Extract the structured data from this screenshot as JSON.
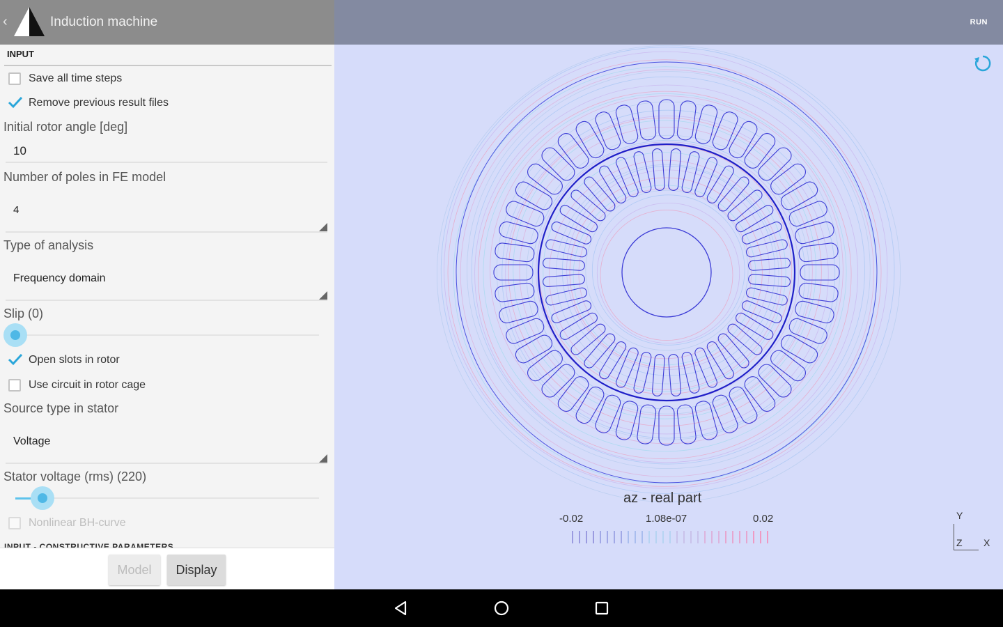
{
  "app": {
    "title": "Induction machine",
    "run_label": "RUN"
  },
  "input": {
    "section_title": "INPUT",
    "save_steps": {
      "label": "Save all time steps",
      "checked": false
    },
    "remove_files": {
      "label": "Remove previous result files",
      "checked": true
    },
    "rotor_angle": {
      "label": "Initial rotor angle [deg]",
      "value": "10"
    },
    "poles": {
      "label": "Number of poles in FE model",
      "value": "4"
    },
    "analysis": {
      "label": "Type of analysis",
      "value": "Frequency domain"
    },
    "slip": {
      "label": "Slip (0)",
      "value": 0
    },
    "open_slots": {
      "label": "Open slots in rotor",
      "checked": true
    },
    "use_circuit": {
      "label": "Use circuit in rotor cage",
      "checked": false
    },
    "source_type": {
      "label": "Source type in stator",
      "value": "Voltage"
    },
    "stator_voltage": {
      "label": "Stator voltage (rms) (220)",
      "value": 0.09
    },
    "nonlinear": {
      "label": "Nonlinear BH-curve",
      "checked": false
    },
    "next_section": "INPUT - CONSTRUCTIVE PARAMETERS"
  },
  "buttons": {
    "model": "Model",
    "display": "Display"
  },
  "plot": {
    "label": "az - real part",
    "ticks": {
      "min": "-0.02",
      "mid": "1.08e-07",
      "max": "0.02"
    },
    "axes": {
      "y": "Y",
      "z": "Z",
      "x": "X"
    }
  },
  "colors": {
    "accent": "#4fb8e6",
    "viewport_bg": "#d6dcfa",
    "motor_line": "#1f1fc8"
  },
  "icons": {
    "back": "back-icon",
    "refresh": "refresh-icon",
    "nav": [
      "back-triangle-icon",
      "home-circle-icon",
      "recents-square-icon"
    ]
  }
}
